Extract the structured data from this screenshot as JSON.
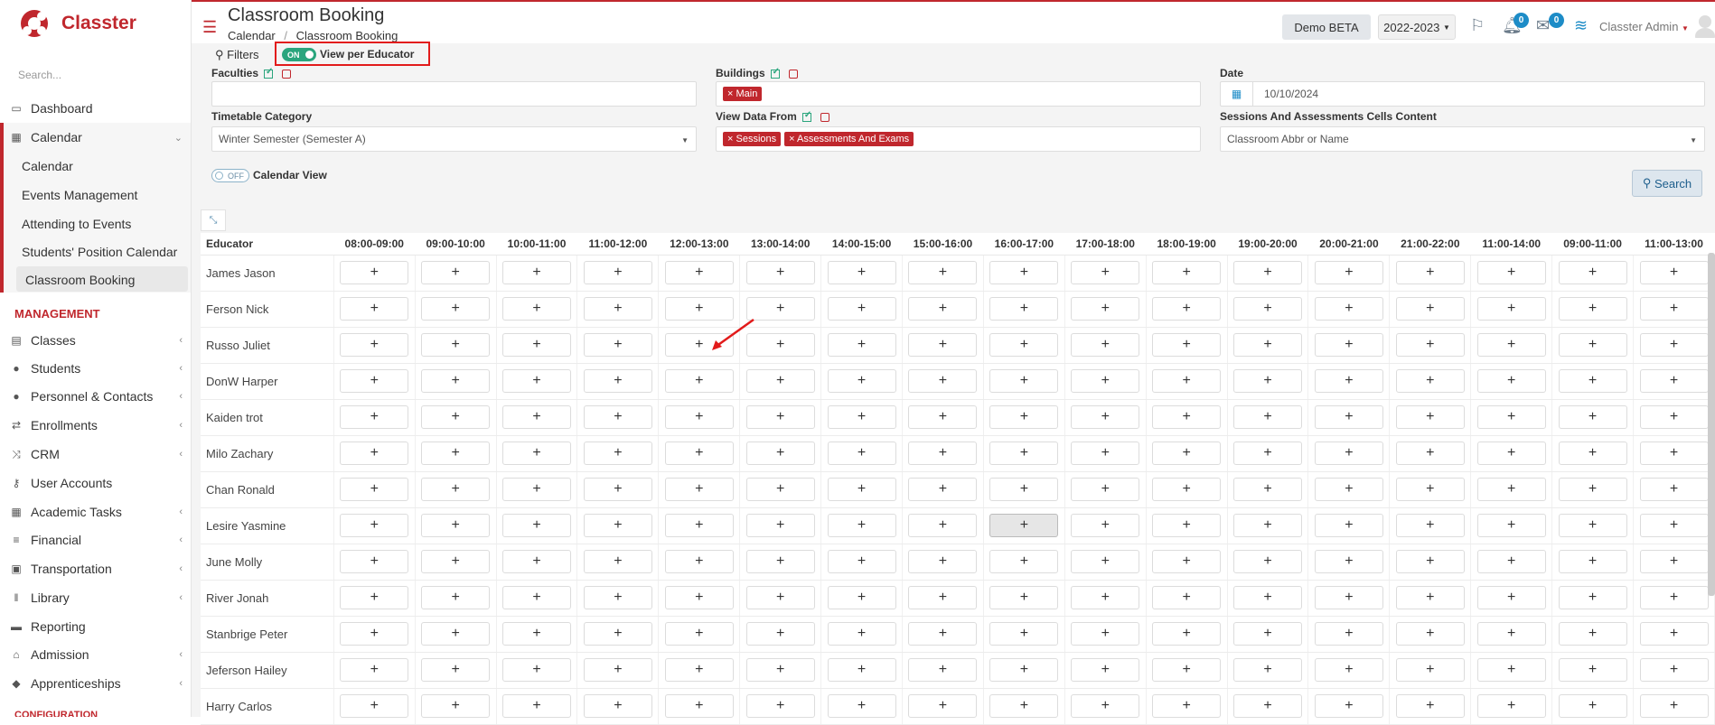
{
  "app": {
    "name": "Classter",
    "search_placeholder": "Search..."
  },
  "sidebar": {
    "dashboard": "Dashboard",
    "calendar": "Calendar",
    "calendar_sub": [
      "Calendar",
      "Events Management",
      "Attending to Events",
      "Students' Position Calendar",
      "Classroom Booking"
    ],
    "management_heading": "MANAGEMENT",
    "items": [
      "Classes",
      "Students",
      "Personnel & Contacts",
      "Enrollments",
      "CRM",
      "User Accounts",
      "Academic Tasks",
      "Financial",
      "Transportation",
      "Library",
      "Reporting",
      "Admission",
      "Apprenticeships"
    ],
    "configuration_heading": "CONFIGURATION"
  },
  "header": {
    "title": "Classroom Booking",
    "breadcrumb_1": "Calendar",
    "breadcrumb_sep": "/",
    "breadcrumb_2": "Classroom Booking",
    "demo_label": "Demo BETA",
    "year": "2022-2023",
    "notif_count": "0",
    "msg_count": "0",
    "user": "Classter Admin"
  },
  "filters": {
    "filters_label": "Filters",
    "toggle_state": "ON",
    "view_per_educator": "View per Educator",
    "faculties_label": "Faculties",
    "buildings_label": "Buildings",
    "buildings_tags": [
      "Main"
    ],
    "date_label": "Date",
    "date_value": "10/10/2024",
    "timetable_label": "Timetable Category",
    "timetable_value": "Winter Semester (Semester A)",
    "view_data_label": "View Data From",
    "view_data_tags": [
      "Sessions",
      "Assessments And Exams"
    ],
    "sessions_label": "Sessions And Assessments Cells Content",
    "sessions_value": "Classroom Abbr or Name",
    "calendar_toggle": "OFF",
    "calendar_view_label": "Calendar View",
    "search_button": "Search"
  },
  "grid": {
    "educator_header": "Educator",
    "time_slots": [
      "08:00-09:00",
      "09:00-10:00",
      "10:00-11:00",
      "11:00-12:00",
      "12:00-13:00",
      "13:00-14:00",
      "14:00-15:00",
      "15:00-16:00",
      "16:00-17:00",
      "17:00-18:00",
      "18:00-19:00",
      "19:00-20:00",
      "20:00-21:00",
      "21:00-22:00",
      "11:00-14:00",
      "09:00-11:00",
      "11:00-13:00"
    ],
    "educators": [
      "James Jason",
      "Ferson Nick",
      "Russo Juliet",
      "DonW Harper",
      "Kaiden trot",
      "Milo Zachary",
      "Chan Ronald",
      "Lesire Yasmine",
      "June Molly",
      "River Jonah",
      "Stanbrige Peter",
      "Jeferson Hailey",
      "Harry Carlos"
    ],
    "add_symbol": "+",
    "selected_cell": {
      "educator": "Lesire Yasmine",
      "slot": "16:00-17:00"
    }
  },
  "colors": {
    "brand": "#c0272d",
    "toggle_on": "#2aa57d",
    "badge": "#1d8cc7",
    "highlight": "#e21b1b"
  }
}
